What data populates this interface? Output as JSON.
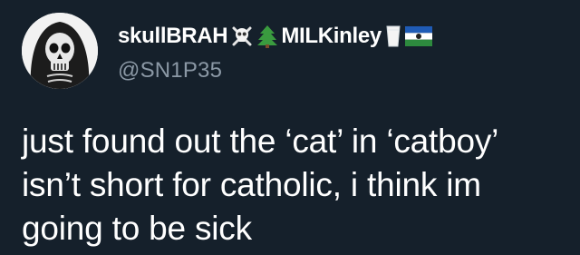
{
  "author": {
    "display_name": "skullBRAH",
    "display_name_suffix": "MILKinley",
    "handle": "@SN1P35",
    "name_emojis_1": [
      "skull-crossbones-icon",
      "christmas-tree-icon"
    ],
    "name_emojis_2": [
      "milk-glass-icon",
      "flag-icon"
    ]
  },
  "tweet": {
    "lines": [
      "just found out the ‘cat’ in ‘catboy’",
      "isn’t short for catholic, i think im",
      "going to be sick"
    ]
  },
  "colors": {
    "background": "#15202b",
    "text": "#ffffff",
    "secondary_text": "#8b98a5"
  }
}
